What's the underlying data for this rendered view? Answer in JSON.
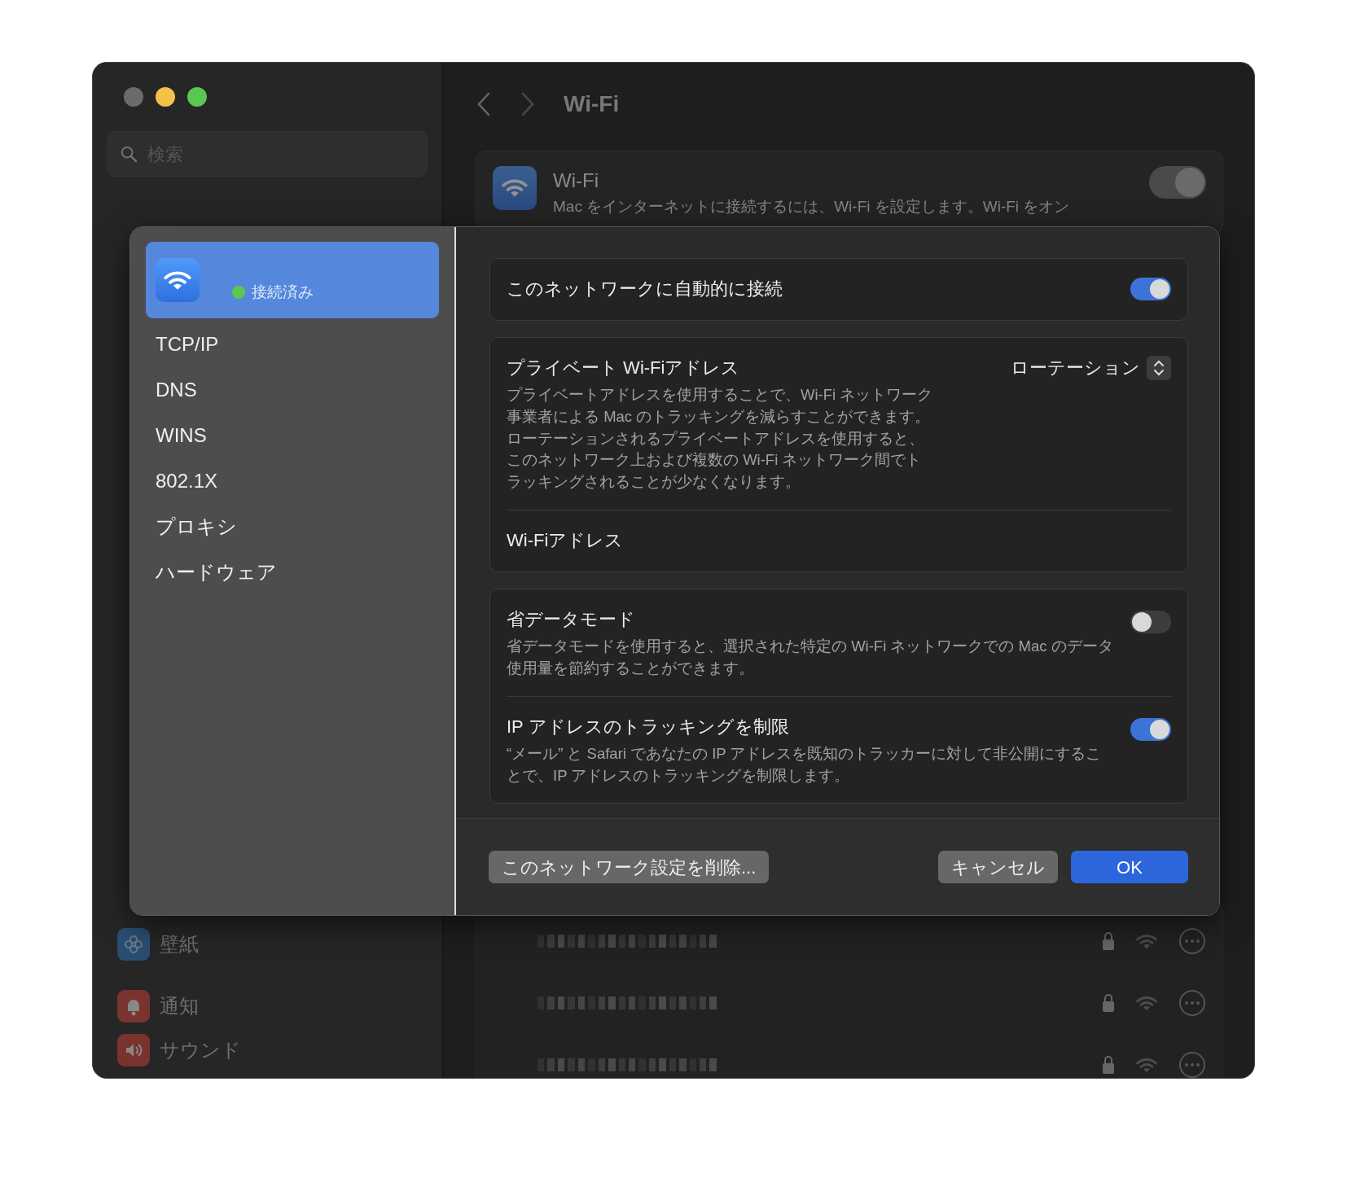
{
  "window": {
    "title": "Wi-Fi",
    "search": {
      "placeholder": "検索"
    }
  },
  "sidebar": {
    "items": [
      {
        "label": "壁紙",
        "kind": "wallpaper"
      },
      {
        "label": "通知",
        "kind": "notifications"
      },
      {
        "label": "サウンド",
        "kind": "sound"
      }
    ]
  },
  "wifi_card": {
    "title": "Wi-Fi",
    "description": "Mac をインターネットに接続するには、Wi-Fi を設定します。Wi-Fi をオン",
    "on": true
  },
  "networks": [
    {
      "kind": "redacted"
    },
    {
      "kind": "redacted"
    },
    {
      "kind": "redacted"
    }
  ],
  "sheet": {
    "sidebar": {
      "items": [
        {
          "kind": "network",
          "status": "接続済み",
          "color": "#5ac84f",
          "selected": true
        },
        {
          "kind": "text",
          "label": "TCP/IP",
          "selected": false
        },
        {
          "kind": "text",
          "label": "DNS",
          "selected": false
        },
        {
          "kind": "text",
          "label": "WINS",
          "selected": false
        },
        {
          "kind": "text",
          "label": "802.1X",
          "selected": false
        },
        {
          "kind": "text",
          "label": "プロキシ",
          "selected": false
        },
        {
          "kind": "text",
          "label": "ハードウェア",
          "selected": false
        }
      ]
    },
    "groups": [
      [
        {
          "kind": "toggle",
          "title": "このネットワークに自動的に接続",
          "on": true
        }
      ],
      [
        {
          "kind": "popup",
          "title": "プライベート Wi-Fiアドレス",
          "description": "プライベートアドレスを使用することで、Wi-Fi ネットワーク事業者による Mac のトラッキングを減らすことができます。ローテーションされるプライベートアドレスを使用すると、このネットワーク上および複数の Wi-Fi ネットワーク間でトラッキングされることが少なくなります。",
          "value": "ローテーション"
        },
        {
          "kind": "plain",
          "title": "Wi-Fiアドレス"
        }
      ],
      [
        {
          "kind": "toggle",
          "title": "省データモード",
          "description": "省データモードを使用すると、選択された特定の Wi-Fi ネットワークでの Mac のデータ使用量を節約することができます。",
          "on": false
        },
        {
          "kind": "toggle",
          "title": "IP アドレスのトラッキングを制限",
          "description": "“メール” と Safari であなたの IP アドレスを既知のトラッカーに対して非公開にすることで、IP アドレスのトラッキングを制限します。",
          "on": true
        }
      ]
    ],
    "footer": {
      "left_buttons": [
        {
          "label": "このネットワーク設定を削除...",
          "kind": "secondary"
        }
      ],
      "right_buttons": [
        {
          "label": "キャンセル",
          "kind": "secondary"
        },
        {
          "label": "OK",
          "kind": "primary"
        }
      ]
    }
  }
}
